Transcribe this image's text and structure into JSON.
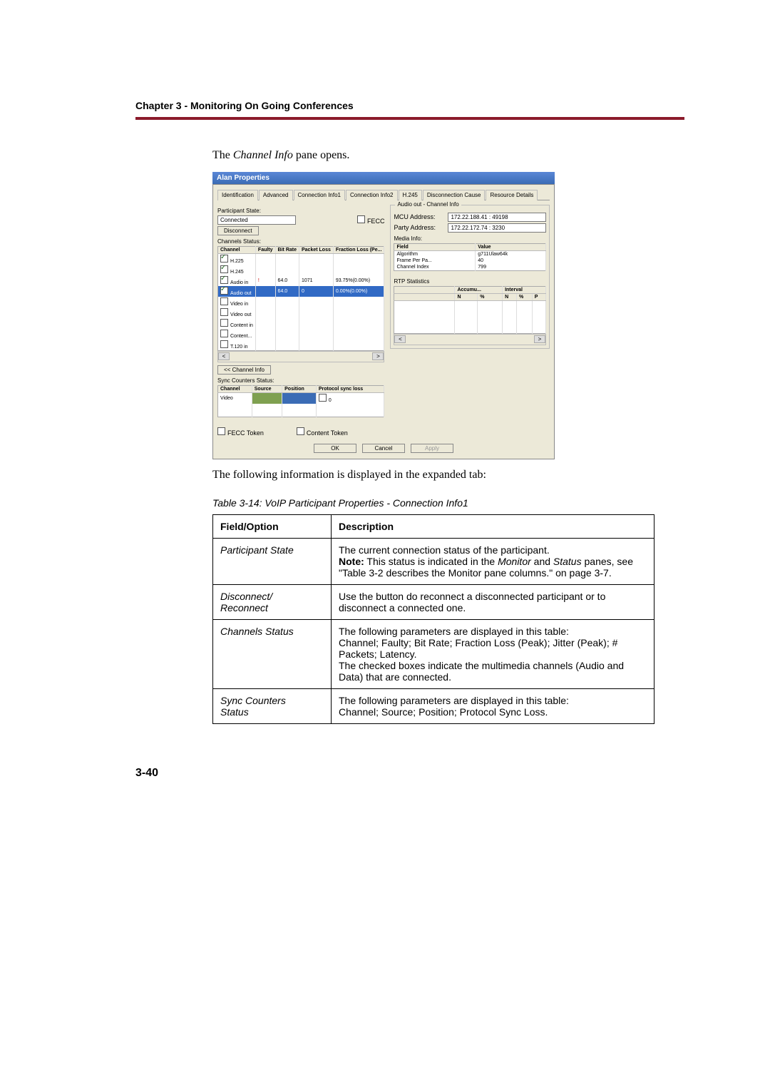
{
  "chapter_header": "Chapter 3 - Monitoring On Going Conferences",
  "intro_text_pre": "The ",
  "intro_text_em": "Channel Info",
  "intro_text_post": " pane opens.",
  "dialog": {
    "title": "Alan Properties",
    "tabs": [
      "Identification",
      "Advanced",
      "Connection Info1",
      "Connection Info2",
      "H.245",
      "Disconnection Cause",
      "Resource Details"
    ],
    "participant_state_label": "Participant State:",
    "participant_state_value": "Connected",
    "fecc_label": "FECC",
    "disconnect_btn": "Disconnect",
    "channels_status_label": "Channels Status:",
    "channels_headers": [
      "Channel",
      "Faulty",
      "Bit Rate",
      "Packet Loss",
      "Fraction Loss (Pe..."
    ],
    "channels_rows": [
      {
        "name": "H.225",
        "checked": true,
        "faulty": "",
        "bitrate": "",
        "ploss": "",
        "floss": ""
      },
      {
        "name": "H.245",
        "checked": true,
        "faulty": "",
        "bitrate": "",
        "ploss": "",
        "floss": ""
      },
      {
        "name": "Audio in",
        "checked": true,
        "faulty": "!",
        "bitrate": "64.0",
        "ploss": "1071",
        "floss": "93.75%(0.00%)"
      },
      {
        "name": "Audio out",
        "checked": true,
        "faulty": "",
        "bitrate": "64.0",
        "ploss": "0",
        "floss": "0.00%(0.00%)",
        "selected": true
      },
      {
        "name": "Video in",
        "checked": false,
        "faulty": "",
        "bitrate": "",
        "ploss": "",
        "floss": ""
      },
      {
        "name": "Video out",
        "checked": false,
        "faulty": "",
        "bitrate": "",
        "ploss": "",
        "floss": ""
      },
      {
        "name": "Content in",
        "checked": false,
        "faulty": "",
        "bitrate": "",
        "ploss": "",
        "floss": ""
      },
      {
        "name": "Content...",
        "checked": false,
        "faulty": "",
        "bitrate": "",
        "ploss": "",
        "floss": ""
      },
      {
        "name": "T.120 in",
        "checked": false,
        "faulty": "",
        "bitrate": "",
        "ploss": "",
        "floss": ""
      }
    ],
    "channel_info_btn": "<< Channel Info",
    "sync_counters_label": "Sync Counters Status:",
    "sync_headers": [
      "Channel",
      "Source",
      "Position",
      "Protocol sync loss"
    ],
    "sync_row": {
      "channel": "Video",
      "source": "",
      "position": "",
      "loss": "0"
    },
    "fecc_token_label": "FECC Token",
    "content_token_label": "Content Token",
    "right_group_title": "Audio out - Channel Info",
    "mcu_address_label": "MCU Address:",
    "mcu_address_value": "172.22.188.41 : 49198",
    "party_address_label": "Party Address:",
    "party_address_value": "172.22.172.74 : 3230",
    "media_info_label": "Media Info:",
    "media_headers": [
      "Field",
      "Value"
    ],
    "media_rows": [
      {
        "field": "Algorithm",
        "value": "g711Ulaw64k"
      },
      {
        "field": "Frame Per Pa...",
        "value": "40"
      },
      {
        "field": "Channel Index",
        "value": "799"
      }
    ],
    "rtp_label": "RTP Statistics",
    "rtp_headers_top": [
      "",
      "Accumu...",
      "Interval"
    ],
    "rtp_headers_sub": [
      "",
      "N",
      "%",
      "N",
      "%",
      "P"
    ],
    "ok_btn": "OK",
    "cancel_btn": "Cancel",
    "apply_btn": "Apply"
  },
  "followup_text": "The following information is displayed in the expanded tab:",
  "table_caption": "Table 3-14: VoIP Participant Properties - Connection Info1",
  "table": {
    "header_field": "Field/Option",
    "header_desc": "Description",
    "rows": [
      {
        "field": "Participant State",
        "desc": "The current connection status of the participant.\nNote: This status is indicated in the Monitor and Status panes, see \"Table 3-2 describes the Monitor pane columns.\" on page 3-7."
      },
      {
        "field": "Disconnect/​Reconnect",
        "desc": "Use the button do reconnect a disconnected participant or to disconnect a connected one."
      },
      {
        "field": "Channels Status",
        "desc": "The following parameters are displayed in this table:\nChannel; Faulty; Bit Rate; Fraction Loss (Peak); Jitter (Peak); # Packets; Latency.\nThe checked boxes indicate the multimedia channels (Audio and Data) that are connected."
      },
      {
        "field": "Sync Counters Status",
        "desc": "The following parameters are displayed in this table:\nChannel; Source; Position; Protocol Sync Loss."
      }
    ]
  },
  "page_number": "3-40"
}
